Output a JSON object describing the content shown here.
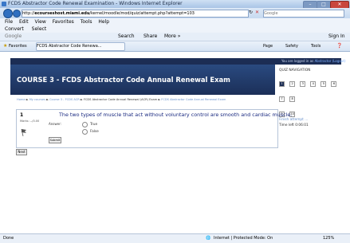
{
  "window": {
    "title": "FCDS Abstractor Code Renewal Examination - Windows Internet Explorer"
  },
  "address": {
    "url_prefix": "http://",
    "url_domain": "ecourseshost.miami.edu",
    "url_path": "/kernel/moodle/mod/quiz/attempt.php?attempt=103",
    "search_placeholder": "Google"
  },
  "menubar": {
    "items": [
      "File",
      "Edit",
      "View",
      "Favorites",
      "Tools",
      "Help"
    ]
  },
  "links_bar": {
    "convert": "Convert",
    "select": "Select"
  },
  "toolbar3": {
    "search_box": "Google",
    "search_btn": "Search",
    "share_btn": "Share",
    "more": "More »",
    "sign_in": "Sign In"
  },
  "favorites": {
    "label": "Favorites",
    "tab_title": "FCDS Abstractor Code Renewa...",
    "page": "Page",
    "safety": "Safety",
    "tools": "Tools"
  },
  "banner": {
    "title": "COURSE 3 - FCDS Abstractor Code Annual Renewal Exam",
    "logged_in_prefix": "You are logged in as",
    "logged_in_user": "Abstractor (Logout)"
  },
  "quiz_nav": {
    "title": "QUIZ NAVIGATION",
    "boxes": [
      "1",
      "2",
      "3",
      "4",
      "5",
      "6",
      "7",
      "8"
    ],
    "row2": [
      "9",
      "10"
    ],
    "finish": "Finish attempt ...",
    "time_left": "Time left 0:06:01"
  },
  "breadcrumb": {
    "home": "Home",
    "sep": " ► ",
    "my_courses": "My courses",
    "course": "Course 3 - FCDS ACR",
    "quiz": "FCDS Abstractor Code Annual Renewal (ACR) Exam",
    "attempt": "FCDS Abstractor Code Annual Renewal Exam"
  },
  "question": {
    "number": "1",
    "marks": "Marks: --/0.00",
    "text": "The two types of muscle that act without voluntary control are smooth and cardiac muscle.",
    "answer_label": "Answer:",
    "options": [
      "True",
      "False"
    ],
    "submit": "Submit"
  },
  "next_btn": "Next",
  "status": {
    "left": "Done",
    "zone": "Internet | Protected Mode: On",
    "zoom": "125%"
  }
}
